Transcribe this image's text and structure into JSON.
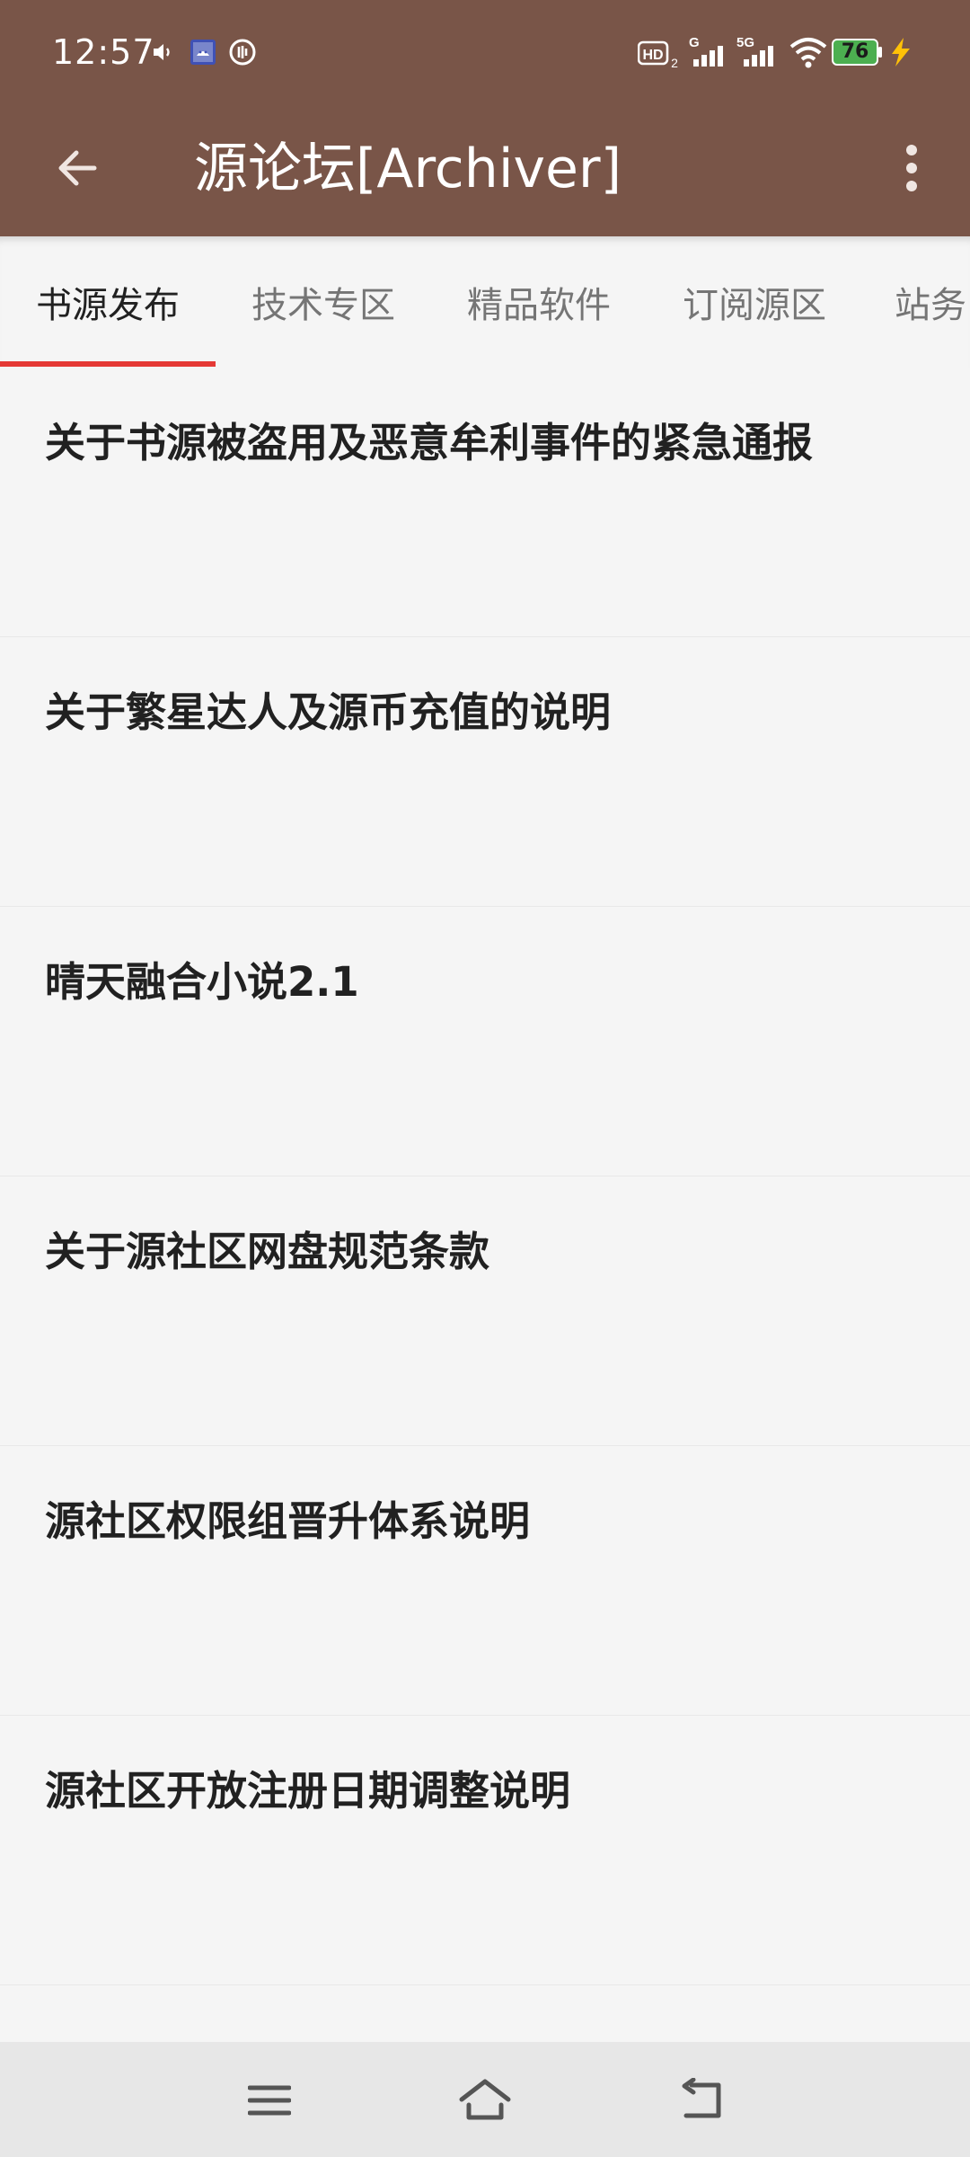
{
  "status_bar": {
    "time": "12:57",
    "battery": "76",
    "network_5g": "5G",
    "network_g": "G",
    "hd_badge": "HD"
  },
  "app_bar": {
    "title": "源论坛[Archiver]",
    "back_icon": "arrow-left-icon",
    "more_icon": "more-vert-icon"
  },
  "tabs": [
    {
      "label": "书源发布",
      "active": true
    },
    {
      "label": "技术专区",
      "active": false
    },
    {
      "label": "精品软件",
      "active": false
    },
    {
      "label": "订阅源区",
      "active": false
    },
    {
      "label": "站务",
      "active": false
    }
  ],
  "threads": [
    {
      "title": "关于书源被盗用及恶意牟利事件的紧急通报"
    },
    {
      "title": "关于繁星达人及源币充值的说明"
    },
    {
      "title": "晴天融合小说2.1"
    },
    {
      "title": "关于源社区网盘规范条款"
    },
    {
      "title": "源社区权限组晋升体系说明"
    },
    {
      "title": "源社区开放注册日期调整说明"
    }
  ],
  "nav_bar": {
    "menu_icon": "menu-icon",
    "home_icon": "home-icon",
    "back_icon": "back-icon"
  },
  "colors": {
    "app_bar": "#795548",
    "tab_indicator": "#e53935",
    "battery": "#4caf50"
  }
}
